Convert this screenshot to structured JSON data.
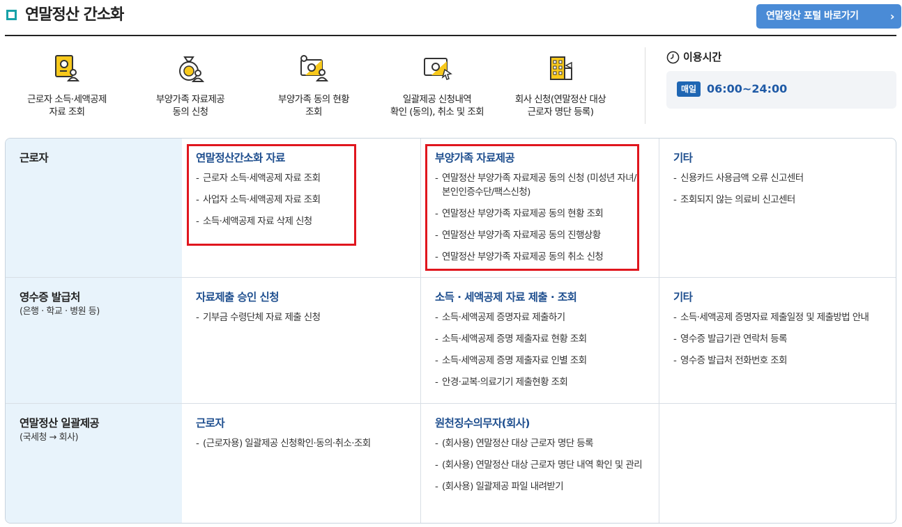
{
  "header": {
    "title": "연말정산 간소화",
    "portal_button": "연말정산 포털 바로가기",
    "portal_chevron": "›"
  },
  "quick_menu": [
    {
      "icon": "worker-document-icon",
      "line1": "근로자 소득·세액공제",
      "line2": "자료 조회"
    },
    {
      "icon": "money-bag-icon",
      "line1": "부양가족 자료제공",
      "line2": "동의 신청"
    },
    {
      "icon": "dependent-status-icon",
      "line1": "부양가족 동의 현황",
      "line2": "조회"
    },
    {
      "icon": "bulk-provision-icon",
      "line1": "일괄제공 신청내역",
      "line2": "확인 (동의), 취소 및 조회"
    },
    {
      "icon": "company-building-icon",
      "line1": "회사 신청(연말정산 대상",
      "line2": "근로자 명단 등록)"
    }
  ],
  "usage": {
    "title": "이용시간",
    "badge": "매일",
    "hours": "06:00~24:00"
  },
  "rows": [
    {
      "title": "근로자",
      "sub": "",
      "cols": [
        {
          "title": "연말정산간소화 자료",
          "links": [
            "근로자 소득·세액공제 자료 조회",
            "사업자 소득·세액공제 자료 조회",
            "소득·세액공제 자료 삭제 신청"
          ]
        },
        {
          "title": "부양가족 자료제공",
          "links": [
            "연말정산 부양가족 자료제공 동의 신청 (미성년 자녀/본인인증수단/팩스신청)",
            "연말정산 부양가족 자료제공 동의 현황 조회",
            "연말정산 부양가족 자료제공 동의 진행상황",
            "연말정산 부양가족 자료제공 동의 취소 신청"
          ]
        },
        {
          "title": "기타",
          "links": [
            "신용카드 사용금액 오류 신고센터",
            "조회되지 않는 의료비 신고센터"
          ]
        }
      ]
    },
    {
      "title": "영수증 발급처",
      "sub": "(은행 · 학교 · 병원 등)",
      "cols": [
        {
          "title": "자료제출 승인 신청",
          "links": [
            "기부금 수령단체 자료 제출 신청"
          ]
        },
        {
          "title": "소득 · 세액공제 자료 제출 · 조회",
          "links": [
            "소득·세액공제 증명자료 제출하기",
            "소득·세액공제 증명 제출자료 현황 조회",
            "소득·세액공제 증명 제출자료 인별 조회",
            "안경·교복·의료기기 제출현황 조회"
          ]
        },
        {
          "title": "기타",
          "links": [
            "소득·세액공제 증명자료 제출일정 및 제출방법 안내",
            "영수증 발급기관 연락처 등록",
            "영수증 발급처 전화번호 조회"
          ]
        }
      ]
    },
    {
      "title": "연말정산 일괄제공",
      "sub": "(국세청 → 회사)",
      "cols": [
        {
          "title": "근로자",
          "links": [
            "(근로자용) 일괄제공 신청확인·동의·취소·조회"
          ]
        },
        {
          "title": "원천징수의무자(회사)",
          "links": [
            "(회사용) 연말정산 대상 근로자 명단 등록",
            "(회사용) 연말정산 대상 근로자 명단 내역 확인 및 관리",
            "(회사용) 일괄제공 파일 내려받기"
          ]
        },
        {
          "title": "",
          "links": []
        }
      ]
    }
  ],
  "colors": {
    "accent": "#4a8bd6",
    "link_title": "#1f4f8f",
    "highlight": "#e0161e",
    "header_cell": "#e8f3fb",
    "title_mark": "#17a1a8"
  }
}
